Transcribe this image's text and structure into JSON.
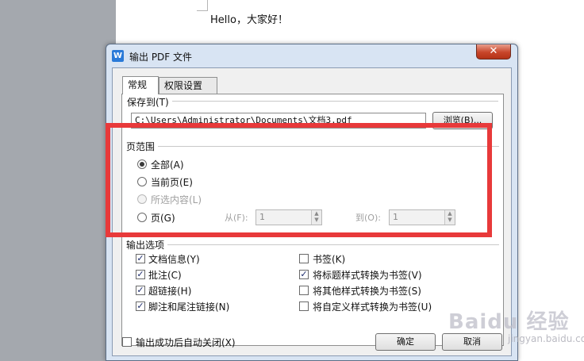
{
  "document": {
    "body_text": "Hello，大家好！"
  },
  "dialog": {
    "title": "输出 PDF 文件",
    "app_icon_glyph": "W",
    "close_glyph": "✕",
    "tabs": [
      {
        "label": "常规",
        "active": true
      },
      {
        "label": "权限设置",
        "active": false
      }
    ],
    "save_to": {
      "group_label": "保存到(T)",
      "path_value": "C:\\Users\\Administrator\\Documents\\文档3.pdf",
      "browse_label": "浏览(B)..."
    },
    "page_range": {
      "group_label": "页范围",
      "options": [
        {
          "label": "全部(A)",
          "checked": true,
          "disabled": false
        },
        {
          "label": "当前页(E)",
          "checked": false,
          "disabled": false
        },
        {
          "label": "所选内容(L)",
          "checked": false,
          "disabled": true
        },
        {
          "label": "页(G)",
          "checked": false,
          "disabled": false
        }
      ],
      "from_label": "从(F):",
      "from_value": "1",
      "to_label": "到(O):",
      "to_value": "1"
    },
    "output_options": {
      "group_label": "输出选项",
      "left": [
        {
          "label": "文档信息(Y)",
          "checked": true
        },
        {
          "label": "批注(C)",
          "checked": true
        },
        {
          "label": "超链接(H)",
          "checked": true
        },
        {
          "label": "脚注和尾注链接(N)",
          "checked": true
        }
      ],
      "right": [
        {
          "label": "书签(K)",
          "checked": false
        },
        {
          "label": "将标题样式转换为书签(V)",
          "checked": true
        },
        {
          "label": "将其他样式转换为书签(S)",
          "checked": false
        },
        {
          "label": "将自定义样式转换为书签(U)",
          "checked": false
        }
      ]
    },
    "auto_close": {
      "label": "输出成功后自动关闭(X)",
      "checked": false
    },
    "ok_label": "确定",
    "cancel_label": "取消"
  },
  "annotation": {
    "highlight_color": "#e8393a"
  },
  "watermark": {
    "text": "Baidu 经验",
    "sub": "jingyan.baidu.com"
  }
}
